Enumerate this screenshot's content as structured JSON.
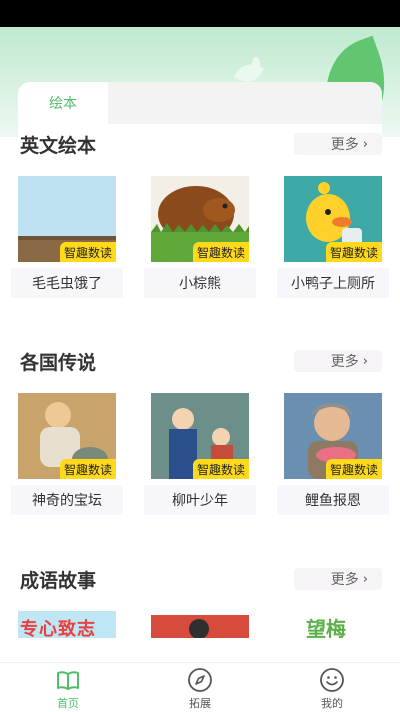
{
  "tabs": [
    {
      "label": "绘本",
      "active": true
    }
  ],
  "badge_label": "智趣数读",
  "sections": [
    {
      "title": "英文绘本",
      "more_label": "更多",
      "items": [
        {
          "title": "毛毛虫饿了"
        },
        {
          "title": "小棕熊"
        },
        {
          "title": "小鸭子上厕所"
        }
      ]
    },
    {
      "title": "各国传说",
      "more_label": "更多",
      "items": [
        {
          "title": "神奇的宝坛"
        },
        {
          "title": "柳叶少年"
        },
        {
          "title": "鲤鱼报恩"
        }
      ]
    },
    {
      "title": "成语故事",
      "more_label": "更多",
      "items": [
        {
          "thumb_text": "专心致志"
        },
        {
          "thumb_text": ""
        },
        {
          "thumb_text": "望梅"
        }
      ]
    }
  ],
  "bottom_nav": [
    {
      "label": "首页",
      "icon": "book-icon",
      "active": true
    },
    {
      "label": "拓展",
      "icon": "compass-icon",
      "active": false
    },
    {
      "label": "我的",
      "icon": "smile-icon",
      "active": false
    }
  ],
  "colors": {
    "accent": "#4fbd69",
    "badge": "#ffd91a"
  }
}
